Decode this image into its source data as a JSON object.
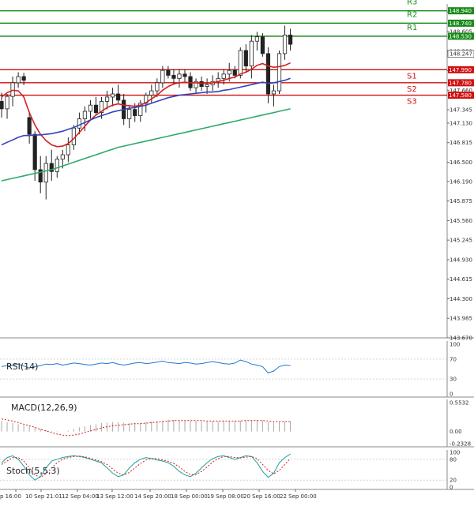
{
  "chart_data": {
    "type": "candlestick",
    "price_axis": {
      "ticks": [
        "148.920",
        "148.605",
        "148.290",
        "147.975",
        "147.660",
        "147.345",
        "147.130",
        "146.815",
        "146.500",
        "146.190",
        "145.875",
        "145.560",
        "145.245",
        "144.930",
        "144.615",
        "144.300",
        "143.985",
        "143.670"
      ],
      "current_price": "148.247",
      "range": [
        143.67,
        149.05
      ]
    },
    "time_axis": {
      "labels": [
        "p 16:00",
        "10 Sep 21:01",
        "12 Sep 04:00",
        "13 Sep 12:00",
        "14 Sep 20:00",
        "18 Sep 00:00",
        "19 Sep 08:00",
        "20 Sep 16:00",
        "22 Sep 00:00"
      ]
    },
    "levels": [
      {
        "name": "R3",
        "value": 148.94,
        "label": "148.940",
        "color": "#1a8a1a"
      },
      {
        "name": "R2",
        "value": 148.74,
        "label": "148.740",
        "color": "#1a8a1a"
      },
      {
        "name": "R1",
        "value": 148.53,
        "label": "148.530",
        "color": "#1a8a1a"
      },
      {
        "name": "S1",
        "value": 147.99,
        "label": "147.990",
        "color": "#d01010"
      },
      {
        "name": "S2",
        "value": 147.78,
        "label": "147.780",
        "color": "#d01010"
      },
      {
        "name": "S3",
        "value": 147.58,
        "label": "147.580",
        "color": "#d01010"
      }
    ],
    "candles": [
      [
        147.48,
        147.62,
        147.22,
        147.36
      ],
      [
        147.36,
        147.6,
        147.2,
        147.56
      ],
      [
        147.56,
        147.88,
        147.4,
        147.78
      ],
      [
        147.78,
        147.95,
        147.7,
        147.88
      ],
      [
        147.88,
        147.94,
        147.74,
        147.82
      ],
      [
        147.22,
        147.32,
        146.8,
        146.95
      ],
      [
        146.95,
        147.0,
        146.2,
        146.38
      ],
      [
        146.38,
        146.6,
        146.0,
        146.18
      ],
      [
        146.18,
        146.6,
        145.9,
        146.48
      ],
      [
        146.48,
        146.7,
        146.2,
        146.35
      ],
      [
        146.35,
        146.6,
        146.25,
        146.55
      ],
      [
        146.55,
        146.7,
        146.4,
        146.62
      ],
      [
        146.62,
        146.9,
        146.5,
        146.78
      ],
      [
        146.78,
        147.1,
        146.7,
        147.05
      ],
      [
        147.05,
        147.3,
        146.95,
        147.2
      ],
      [
        147.2,
        147.4,
        147.0,
        147.32
      ],
      [
        147.32,
        147.5,
        147.2,
        147.42
      ],
      [
        147.42,
        147.55,
        147.25,
        147.3
      ],
      [
        147.3,
        147.55,
        147.2,
        147.48
      ],
      [
        147.48,
        147.65,
        147.35,
        147.55
      ],
      [
        147.55,
        147.7,
        147.4,
        147.6
      ],
      [
        147.6,
        147.75,
        147.45,
        147.5
      ],
      [
        147.5,
        147.6,
        147.1,
        147.2
      ],
      [
        147.2,
        147.4,
        147.05,
        147.35
      ],
      [
        147.35,
        147.45,
        147.15,
        147.25
      ],
      [
        147.25,
        147.5,
        147.15,
        147.45
      ],
      [
        147.45,
        147.62,
        147.3,
        147.58
      ],
      [
        147.58,
        147.75,
        147.45,
        147.65
      ],
      [
        147.65,
        147.85,
        147.55,
        147.78
      ],
      [
        147.78,
        148.05,
        147.7,
        147.98
      ],
      [
        147.98,
        148.05,
        147.85,
        147.9
      ],
      [
        147.9,
        148.0,
        147.75,
        147.85
      ],
      [
        147.85,
        148.0,
        147.7,
        147.92
      ],
      [
        147.92,
        148.0,
        147.8,
        147.88
      ],
      [
        147.88,
        147.95,
        147.65,
        147.7
      ],
      [
        147.7,
        147.85,
        147.6,
        147.8
      ],
      [
        147.8,
        147.88,
        147.65,
        147.72
      ],
      [
        147.72,
        147.85,
        147.6,
        147.75
      ],
      [
        147.75,
        147.9,
        147.65,
        147.8
      ],
      [
        147.8,
        147.95,
        147.7,
        147.85
      ],
      [
        147.85,
        148.0,
        147.75,
        147.92
      ],
      [
        147.92,
        148.1,
        147.8,
        147.98
      ],
      [
        147.98,
        148.05,
        147.85,
        147.9
      ],
      [
        147.9,
        148.35,
        147.85,
        148.3
      ],
      [
        148.3,
        148.4,
        147.95,
        148.05
      ],
      [
        148.05,
        148.55,
        147.85,
        148.45
      ],
      [
        148.45,
        148.6,
        148.3,
        148.52
      ],
      [
        148.52,
        148.58,
        148.2,
        148.25
      ],
      [
        148.25,
        148.35,
        147.45,
        147.6
      ],
      [
        147.6,
        147.75,
        147.4,
        147.65
      ],
      [
        147.65,
        148.3,
        147.6,
        148.25
      ],
      [
        148.25,
        148.7,
        148.15,
        148.55
      ],
      [
        148.55,
        148.65,
        148.3,
        148.4
      ]
    ],
    "ma_series": [
      {
        "color": "#d42020",
        "start": 0,
        "values": [
          147.55,
          147.62,
          147.66,
          147.65,
          147.55,
          147.3,
          147.1,
          146.95,
          146.85,
          146.78,
          146.75,
          146.76,
          146.8,
          146.88,
          146.98,
          147.08,
          147.18,
          147.26,
          147.32,
          147.38,
          147.42,
          147.44,
          147.42,
          147.41,
          147.4,
          147.42,
          147.46,
          147.52,
          147.58,
          147.66,
          147.72,
          147.76,
          147.78,
          147.79,
          147.78,
          147.78,
          147.77,
          147.77,
          147.78,
          147.8,
          147.82,
          147.85,
          147.87,
          147.92,
          147.95,
          148.0,
          148.06,
          148.09,
          148.05,
          148.03,
          148.04,
          148.06,
          148.1
        ]
      },
      {
        "color": "#3344bb",
        "start": 0,
        "values": [
          146.78,
          146.82,
          146.86,
          146.9,
          146.93,
          146.93,
          146.94,
          146.94,
          146.95,
          146.96,
          146.98,
          147.0,
          147.03,
          147.06,
          147.1,
          147.14,
          147.18,
          147.22,
          147.25,
          147.28,
          147.31,
          147.33,
          147.35,
          147.37,
          147.38,
          147.4,
          147.42,
          147.45,
          147.48,
          147.51,
          147.54,
          147.56,
          147.58,
          147.59,
          147.6,
          147.61,
          147.62,
          147.63,
          147.63,
          147.64,
          147.66,
          147.67,
          147.69,
          147.71,
          147.73,
          147.75,
          147.77,
          147.79,
          147.77,
          147.78,
          147.8,
          147.82,
          147.85
        ]
      },
      {
        "color": "#2fa86b",
        "start": 0,
        "values": [
          146.2,
          146.22,
          146.24,
          146.26,
          146.28,
          146.3,
          146.32,
          146.34,
          146.36,
          146.38,
          146.41,
          146.44,
          146.47,
          146.5,
          146.53,
          146.56,
          146.59,
          146.62,
          146.65,
          146.68,
          146.71,
          146.74,
          146.76,
          146.78,
          146.8,
          146.82,
          146.84,
          146.86,
          146.88,
          146.9,
          146.92,
          146.94,
          146.96,
          146.98,
          147.0,
          147.02,
          147.04,
          147.06,
          147.08,
          147.1,
          147.12,
          147.14,
          147.16,
          147.18,
          147.2,
          147.22,
          147.24,
          147.26,
          147.28,
          147.3,
          147.32,
          147.34,
          147.36
        ]
      }
    ],
    "rsi": {
      "title": "RSI(14)",
      "ticks": [
        "100",
        "70",
        "30",
        "0"
      ],
      "values": [
        55,
        57,
        58,
        60,
        56,
        52,
        55,
        57,
        60,
        59,
        61,
        58,
        60,
        62,
        61,
        59,
        58,
        60,
        62,
        61,
        63,
        60,
        58,
        60,
        62,
        63,
        61,
        62,
        64,
        66,
        63,
        62,
        61,
        63,
        62,
        60,
        61,
        63,
        65,
        63,
        61,
        60,
        62,
        68,
        65,
        60,
        58,
        55,
        42,
        46,
        55,
        58,
        57
      ]
    },
    "macd": {
      "title": "MACD(12,26,9)",
      "ticks": [
        "0.5532",
        "0.00",
        "-0.2328"
      ],
      "range": [
        -0.2328,
        0.5532
      ],
      "histogram": [
        0.2,
        0.18,
        0.16,
        0.14,
        0.12,
        0.1,
        0.08,
        0.05,
        0.03,
        0.01,
        -0.01,
        0.0,
        0.02,
        0.05,
        0.08,
        0.1,
        0.12,
        0.14,
        0.16,
        0.17,
        0.18,
        0.18,
        0.17,
        0.16,
        0.16,
        0.17,
        0.18,
        0.19,
        0.2,
        0.21,
        0.22,
        0.22,
        0.21,
        0.21,
        0.2,
        0.2,
        0.19,
        0.19,
        0.19,
        0.19,
        0.2,
        0.2,
        0.2,
        0.21,
        0.21,
        0.21,
        0.22,
        0.21,
        0.18,
        0.17,
        0.18,
        0.19,
        0.19
      ],
      "signal": [
        0.24,
        0.22,
        0.2,
        0.17,
        0.14,
        0.11,
        0.08,
        0.04,
        0.01,
        -0.02,
        -0.05,
        -0.07,
        -0.08,
        -0.07,
        -0.05,
        -0.02,
        0.01,
        0.04,
        0.07,
        0.09,
        0.11,
        0.12,
        0.13,
        0.14,
        0.15,
        0.15,
        0.16,
        0.17,
        0.18,
        0.19,
        0.2,
        0.21,
        0.21,
        0.21,
        0.21,
        0.21,
        0.21,
        0.2,
        0.2,
        0.2,
        0.2,
        0.2,
        0.2,
        0.2,
        0.21,
        0.21,
        0.21,
        0.21,
        0.2,
        0.19,
        0.19,
        0.19,
        0.19
      ]
    },
    "stoch": {
      "title": "Stoch(5,5,3)",
      "ticks": [
        "100",
        "80",
        "20",
        "0"
      ],
      "k": [
        70,
        85,
        90,
        80,
        60,
        35,
        20,
        30,
        55,
        75,
        80,
        85,
        88,
        90,
        88,
        85,
        80,
        75,
        70,
        55,
        40,
        30,
        35,
        55,
        70,
        80,
        85,
        82,
        78,
        75,
        70,
        60,
        45,
        35,
        30,
        40,
        55,
        70,
        82,
        88,
        90,
        85,
        80,
        85,
        90,
        88,
        70,
        45,
        28,
        40,
        70,
        85,
        95
      ],
      "d": [
        65,
        75,
        85,
        85,
        75,
        55,
        35,
        28,
        38,
        55,
        70,
        80,
        85,
        88,
        89,
        87,
        83,
        78,
        73,
        65,
        52,
        40,
        35,
        42,
        55,
        68,
        78,
        82,
        82,
        78,
        74,
        68,
        58,
        45,
        36,
        36,
        45,
        58,
        72,
        82,
        88,
        88,
        85,
        84,
        86,
        88,
        82,
        65,
        48,
        38,
        48,
        65,
        82
      ]
    }
  }
}
